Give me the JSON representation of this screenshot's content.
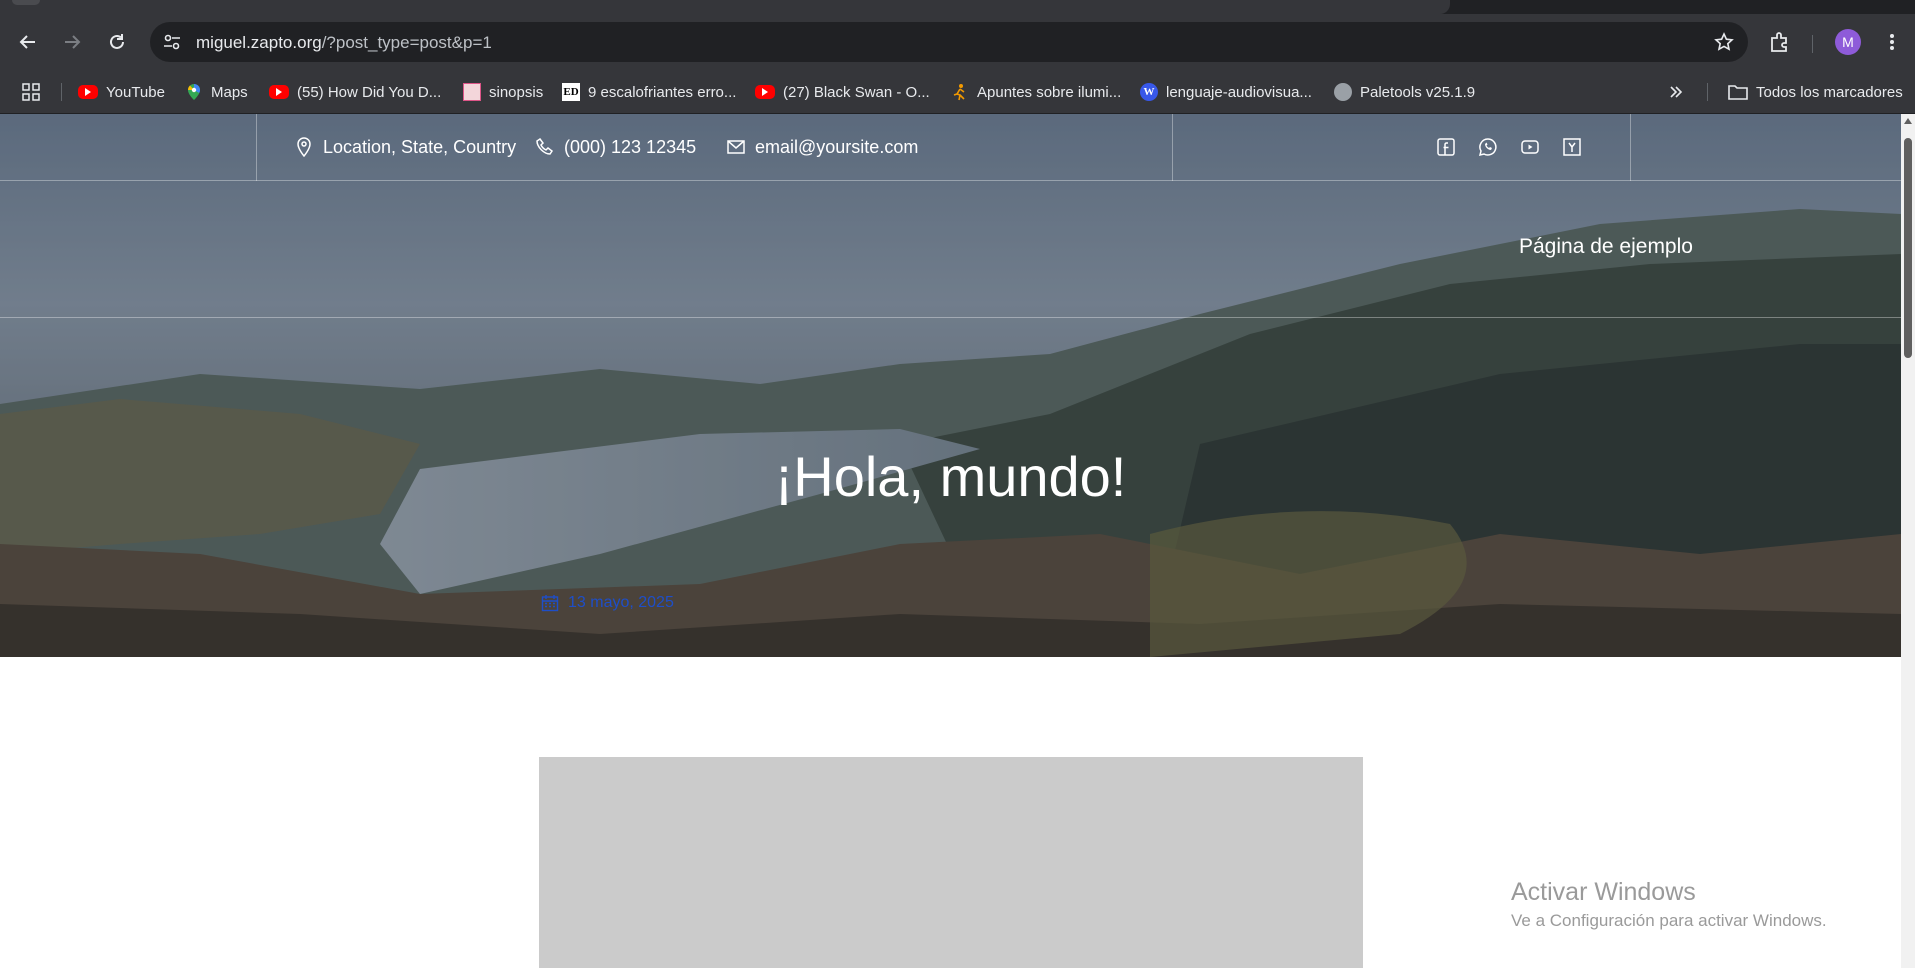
{
  "browser": {
    "clock_partial": "",
    "url_host": "miguel.zapto.org",
    "url_path": "/?post_type=post&p=1",
    "avatar_letter": "M",
    "bookmarks": [
      {
        "label": "YouTube",
        "icon": "youtube-icon"
      },
      {
        "label": "Maps",
        "icon": "maps-icon"
      },
      {
        "label": "(55) How Did You D...",
        "icon": "youtube-icon"
      },
      {
        "label": "sinopsis",
        "icon": "sinopsis-icon"
      },
      {
        "label": "9 escalofriantes erro...",
        "icon": "ed-icon"
      },
      {
        "label": "(27) Black Swan - O...",
        "icon": "youtube-icon"
      },
      {
        "label": "Apuntes sobre ilumi...",
        "icon": "figure-icon"
      },
      {
        "label": "lenguaje-audiovisua...",
        "icon": "wordpress-icon"
      },
      {
        "label": "Paletools v25.1.9",
        "icon": "globe-icon"
      }
    ],
    "all_bookmarks_label": "Todos los marcadores"
  },
  "site": {
    "location": "Location, State, Country",
    "phone": "(000) 123 12345",
    "email": "email@yoursite.com",
    "social_icons": [
      "facebook-icon",
      "whatsapp-icon",
      "youtube-icon",
      "yelp-icon"
    ],
    "nav_link": "Página de ejemplo",
    "hero_title": "¡Hola, mundo!",
    "post_date": "13 mayo, 2025"
  },
  "os": {
    "activate_title": "Activar Windows",
    "activate_subtitle": "Ve a Configuración para activar Windows."
  },
  "colors": {
    "chrome_toolbar": "#35363a",
    "omnibox": "#202124",
    "date_link": "#1e4ec8",
    "placeholder": "#cbcbcb"
  }
}
